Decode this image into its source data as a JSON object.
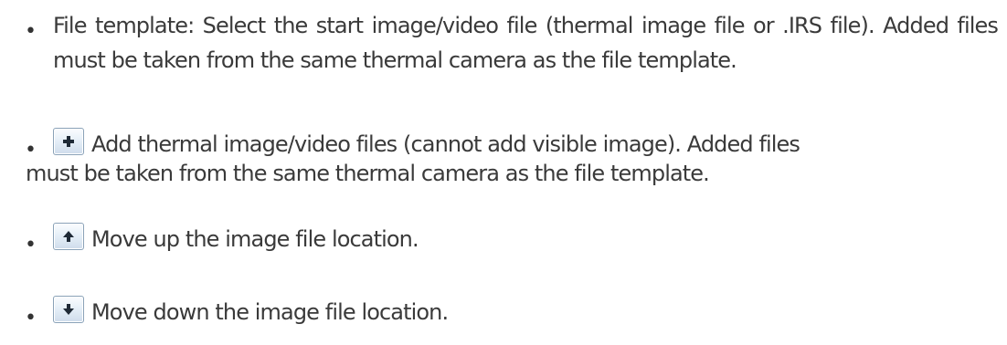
{
  "bullet_char": "•",
  "items": [
    {
      "text": "File template: Select the start image/video file (thermal image file or .IRS file). Added files must be taken from the same thermal camera as the file template."
    },
    {
      "icon": "plus-icon",
      "text_line1": "Add thermal image/video files (cannot add visible image). Added files",
      "text_line2": "must be taken from the same thermal camera as the file template."
    },
    {
      "icon": "arrow-up-icon",
      "text": "Move up the image file location."
    },
    {
      "icon": "arrow-down-icon",
      "text": "Move down the image file location."
    }
  ],
  "colors": {
    "text": "#3a3a3a",
    "icon_glyph": "#1f2a36",
    "button_border": "#8aa2b8"
  }
}
